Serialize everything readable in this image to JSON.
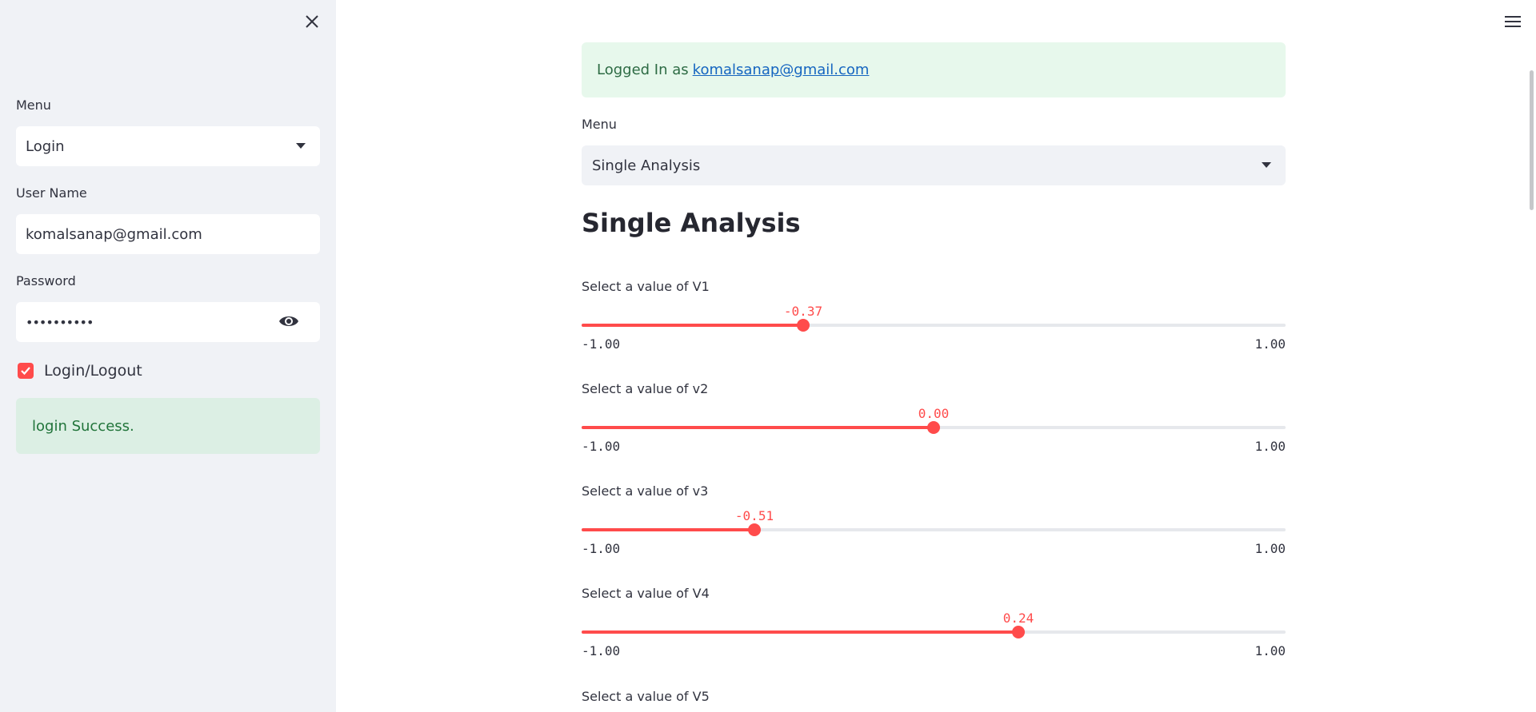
{
  "sidebar": {
    "menu_label": "Menu",
    "menu_value": "Login",
    "username_label": "User Name",
    "username_value": "komalsanap@gmail.com",
    "password_label": "Password",
    "password_value": "••••••••••",
    "checkbox_label": "Login/Logout",
    "checkbox_checked": true,
    "success_message": "login Success."
  },
  "main": {
    "logged_in_prefix": "Logged In as",
    "logged_in_email": "komalsanap@gmail.com",
    "menu_label": "Menu",
    "menu_value": "Single Analysis",
    "page_title": "Single Analysis",
    "sliders": [
      {
        "label": "Select a value of V1",
        "value_text": "-0.37",
        "value": -0.37,
        "min_label": "-1.00",
        "max_label": "1.00",
        "min": -1,
        "max": 1
      },
      {
        "label": "Select a value of v2",
        "value_text": "0.00",
        "value": 0.0,
        "min_label": "-1.00",
        "max_label": "1.00",
        "min": -1,
        "max": 1
      },
      {
        "label": "Select a value of v3",
        "value_text": "-0.51",
        "value": -0.51,
        "min_label": "-1.00",
        "max_label": "1.00",
        "min": -1,
        "max": 1
      },
      {
        "label": "Select a value of V4",
        "value_text": "0.24",
        "value": 0.24,
        "min_label": "-1.00",
        "max_label": "1.00",
        "min": -1,
        "max": 1
      }
    ],
    "next_slider_label": "Select a value of V5"
  },
  "colors": {
    "accent": "#ff4b4b",
    "sidebar_bg": "#f0f2f6",
    "success_bg": "#dcefe4",
    "link": "#1565c0"
  },
  "icons": {
    "close": "close-icon",
    "menu": "hamburger-menu-icon",
    "password_toggle": "eye-icon",
    "dropdown": "chevron-down-icon"
  }
}
